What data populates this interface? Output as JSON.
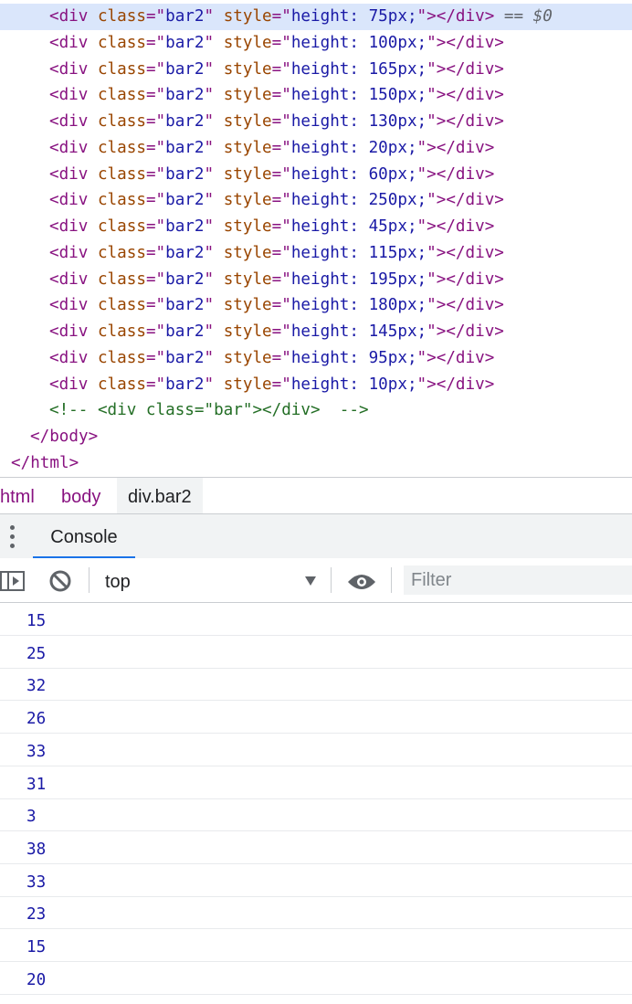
{
  "elements": {
    "selected_marker": "== $0",
    "rows": [
      {
        "tag": "div",
        "attr": "class",
        "class_val": "bar2",
        "attr2": "style",
        "style_val": "height: 75px;"
      },
      {
        "tag": "div",
        "attr": "class",
        "class_val": "bar2",
        "attr2": "style",
        "style_val": "height: 100px;"
      },
      {
        "tag": "div",
        "attr": "class",
        "class_val": "bar2",
        "attr2": "style",
        "style_val": "height: 165px;"
      },
      {
        "tag": "div",
        "attr": "class",
        "class_val": "bar2",
        "attr2": "style",
        "style_val": "height: 150px;"
      },
      {
        "tag": "div",
        "attr": "class",
        "class_val": "bar2",
        "attr2": "style",
        "style_val": "height: 130px;"
      },
      {
        "tag": "div",
        "attr": "class",
        "class_val": "bar2",
        "attr2": "style",
        "style_val": "height: 20px;"
      },
      {
        "tag": "div",
        "attr": "class",
        "class_val": "bar2",
        "attr2": "style",
        "style_val": "height: 60px;"
      },
      {
        "tag": "div",
        "attr": "class",
        "class_val": "bar2",
        "attr2": "style",
        "style_val": "height: 250px;"
      },
      {
        "tag": "div",
        "attr": "class",
        "class_val": "bar2",
        "attr2": "style",
        "style_val": "height: 45px;"
      },
      {
        "tag": "div",
        "attr": "class",
        "class_val": "bar2",
        "attr2": "style",
        "style_val": "height: 115px;"
      },
      {
        "tag": "div",
        "attr": "class",
        "class_val": "bar2",
        "attr2": "style",
        "style_val": "height: 195px;"
      },
      {
        "tag": "div",
        "attr": "class",
        "class_val": "bar2",
        "attr2": "style",
        "style_val": "height: 180px;"
      },
      {
        "tag": "div",
        "attr": "class",
        "class_val": "bar2",
        "attr2": "style",
        "style_val": "height: 145px;"
      },
      {
        "tag": "div",
        "attr": "class",
        "class_val": "bar2",
        "attr2": "style",
        "style_val": "height: 95px;"
      },
      {
        "tag": "div",
        "attr": "class",
        "class_val": "bar2",
        "attr2": "style",
        "style_val": "height: 10px;"
      }
    ],
    "comment": "<!-- <div class=\"bar\"></div>  -->",
    "body_close": "body",
    "html_close": "html"
  },
  "breadcrumb": [
    "html",
    "body",
    "div.bar2"
  ],
  "drawer": {
    "tab": "Console"
  },
  "toolbar": {
    "context": "top",
    "filter_placeholder": "Filter",
    "icons": [
      "sidebar-toggle-icon",
      "clear-console-icon",
      "chevron-down-icon",
      "eye-icon"
    ]
  },
  "console": {
    "messages": [
      "15",
      "25",
      "32",
      "26",
      "33",
      "31",
      "3",
      "38",
      "33",
      "23",
      "15",
      "20"
    ]
  },
  "colors": {
    "selected_row": "#dae6fb",
    "tag": "#881280",
    "attr_name": "#994500",
    "attr_value": "#1a1aa6",
    "comment": "#236e25",
    "number": "#1a1aa6",
    "accent": "#1a73e8"
  }
}
